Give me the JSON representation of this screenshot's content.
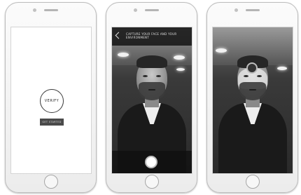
{
  "phones": [
    {
      "screen": "verify",
      "verify_label": "VERIFY",
      "start_label": "GET STARTED"
    },
    {
      "screen": "capture",
      "instruction": "CAPTURE YOUR FACE AND YOUR ENVIRONMENT"
    },
    {
      "screen": "analysis"
    }
  ],
  "colors": {
    "device_body": "#f4f4f4",
    "dark_overlay": "#191919",
    "button": "#4a4a4a"
  },
  "icons": [
    "back-chevron-icon",
    "shutter-icon",
    "face-mask-icon"
  ]
}
